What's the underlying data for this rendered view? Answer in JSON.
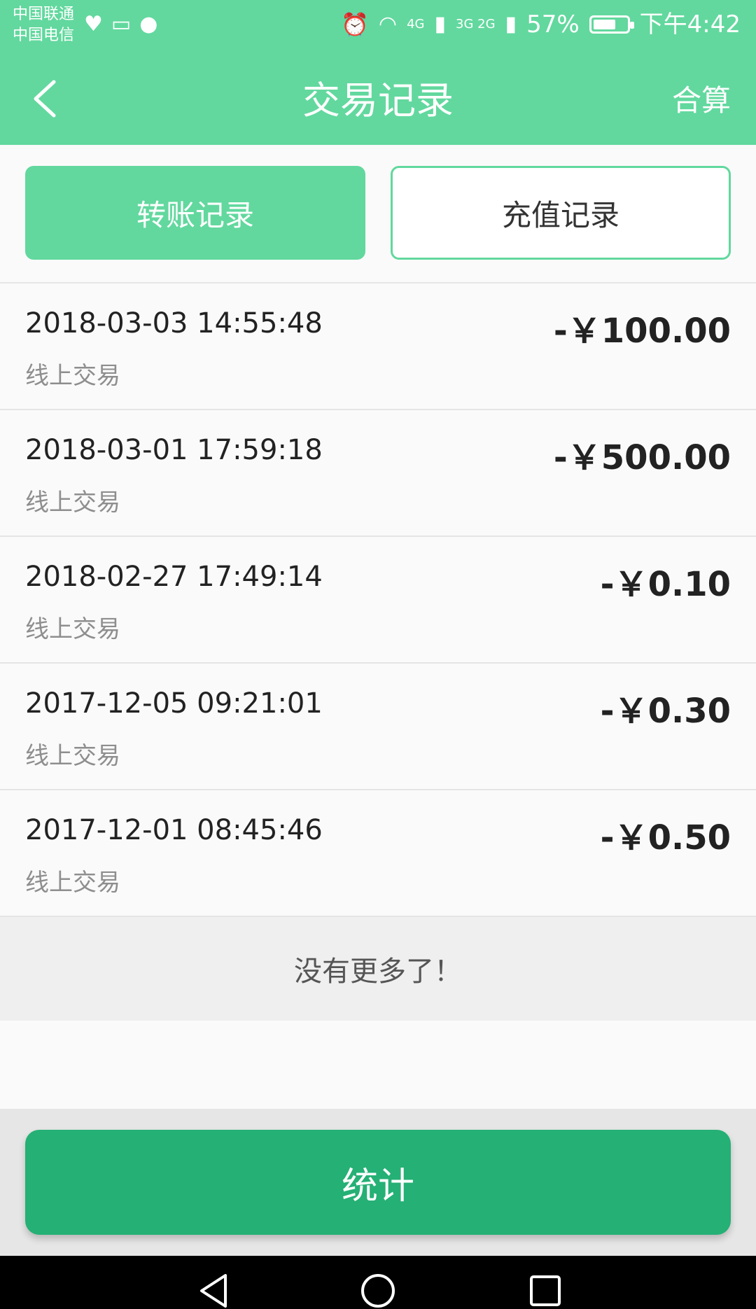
{
  "status_bar": {
    "carrier_1": "中国联通",
    "carrier_2": "中国电信",
    "network_1": "4G",
    "network_2": "3G 2G",
    "battery": "57%",
    "time": "下午4:42"
  },
  "header": {
    "title": "交易记录",
    "right_action": "合算",
    "background_color": "#62d89e"
  },
  "tabs": [
    {
      "label": "转账记录",
      "active": true
    },
    {
      "label": "充值记录",
      "active": false
    }
  ],
  "transactions": [
    {
      "datetime": "2018-03-03 14:55:48",
      "type": "线上交易",
      "amount": "-￥100.00"
    },
    {
      "datetime": "2018-03-01 17:59:18",
      "type": "线上交易",
      "amount": "-￥500.00"
    },
    {
      "datetime": "2018-02-27 17:49:14",
      "type": "线上交易",
      "amount": "-￥0.10"
    },
    {
      "datetime": "2017-12-05 09:21:01",
      "type": "线上交易",
      "amount": "-￥0.30"
    },
    {
      "datetime": "2017-12-01 08:45:46",
      "type": "线上交易",
      "amount": "-￥0.50"
    }
  ],
  "footer_text": "没有更多了！",
  "stats_button": {
    "label": "统计",
    "color": "#25b075"
  },
  "nav_bar": {
    "back_icon": "triangle-back-icon",
    "home_icon": "circle-home-icon",
    "recent_icon": "square-recent-icon"
  }
}
